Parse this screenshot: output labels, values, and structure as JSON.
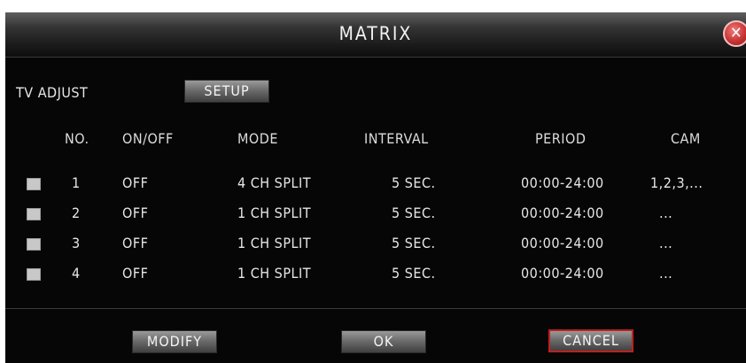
{
  "window": {
    "title": "MATRIX"
  },
  "tv_adjust": {
    "label": "TV ADJUST",
    "setup_button": "SETUP"
  },
  "columns": [
    "NO.",
    "ON/OFF",
    "MODE",
    "INTERVAL",
    "PERIOD",
    "CAM"
  ],
  "rows": [
    {
      "no": "1",
      "onoff": "OFF",
      "mode": "4 CH SPLIT",
      "interval": "5 SEC.",
      "period": "00:00-24:00",
      "cam": "1,2,3,..."
    },
    {
      "no": "2",
      "onoff": "OFF",
      "mode": "1 CH SPLIT",
      "interval": "5 SEC.",
      "period": "00:00-24:00",
      "cam": "..."
    },
    {
      "no": "3",
      "onoff": "OFF",
      "mode": "1 CH SPLIT",
      "interval": "5 SEC.",
      "period": "00:00-24:00",
      "cam": "..."
    },
    {
      "no": "4",
      "onoff": "OFF",
      "mode": "1 CH SPLIT",
      "interval": "5 SEC.",
      "period": "00:00-24:00",
      "cam": "..."
    }
  ],
  "footer": {
    "modify": "MODIFY",
    "ok": "OK",
    "cancel": "CANCEL"
  },
  "icons": {
    "close": "close-icon",
    "checkbox": "checkbox-icon"
  },
  "colors": {
    "background": "#060606",
    "titlebar": "#333333",
    "cancel_border": "#c02020",
    "checkbox": "#c8c8c8"
  }
}
